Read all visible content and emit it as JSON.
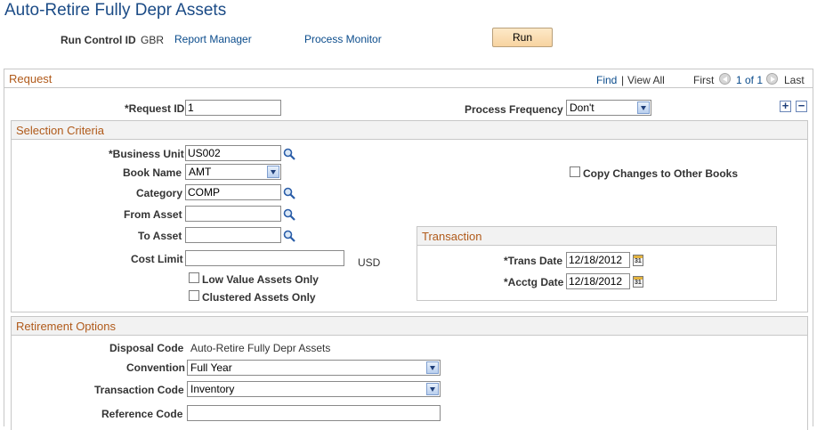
{
  "page": {
    "title": "Auto-Retire Fully Depr Assets"
  },
  "runbar": {
    "run_control_label": "Run Control ID",
    "run_control_value": "GBR",
    "report_manager": "Report Manager",
    "process_monitor": "Process Monitor",
    "run_button": "Run"
  },
  "request": {
    "header": "Request",
    "find": "Find",
    "separator": "|",
    "view_all": "View All",
    "first": "First",
    "pager": "1 of 1",
    "last": "Last",
    "request_id_label": "*Request ID",
    "request_id_value": "1",
    "process_frequency_label": "Process Frequency",
    "process_frequency_value": "Don't",
    "add_label": "+",
    "delete_label": "−"
  },
  "selection": {
    "header": "Selection Criteria",
    "business_unit_label": "*Business Unit",
    "business_unit_value": "US002",
    "book_name_label": "Book Name",
    "book_name_value": "AMT",
    "category_label": "Category",
    "category_value": "COMP",
    "from_asset_label": "From Asset",
    "from_asset_value": "",
    "to_asset_label": "To Asset",
    "to_asset_value": "",
    "cost_limit_label": "Cost Limit",
    "cost_limit_value": "",
    "currency": "USD",
    "low_value_label": "Low Value Assets Only",
    "clustered_label": "Clustered Assets Only",
    "copy_changes_label": "Copy Changes to Other Books"
  },
  "transaction": {
    "header": "Transaction",
    "trans_date_label": "*Trans Date",
    "trans_date_value": "12/18/2012",
    "acctg_date_label": "*Acctg Date",
    "acctg_date_value": "12/18/2012"
  },
  "retirement": {
    "header": "Retirement Options",
    "disposal_code_label": "Disposal Code",
    "disposal_code_value": "Auto-Retire Fully Depr Assets",
    "convention_label": "Convention",
    "convention_value": "Full Year",
    "transaction_code_label": "Transaction Code",
    "transaction_code_value": "Inventory",
    "reference_code_label": "Reference Code",
    "reference_code_value": ""
  }
}
